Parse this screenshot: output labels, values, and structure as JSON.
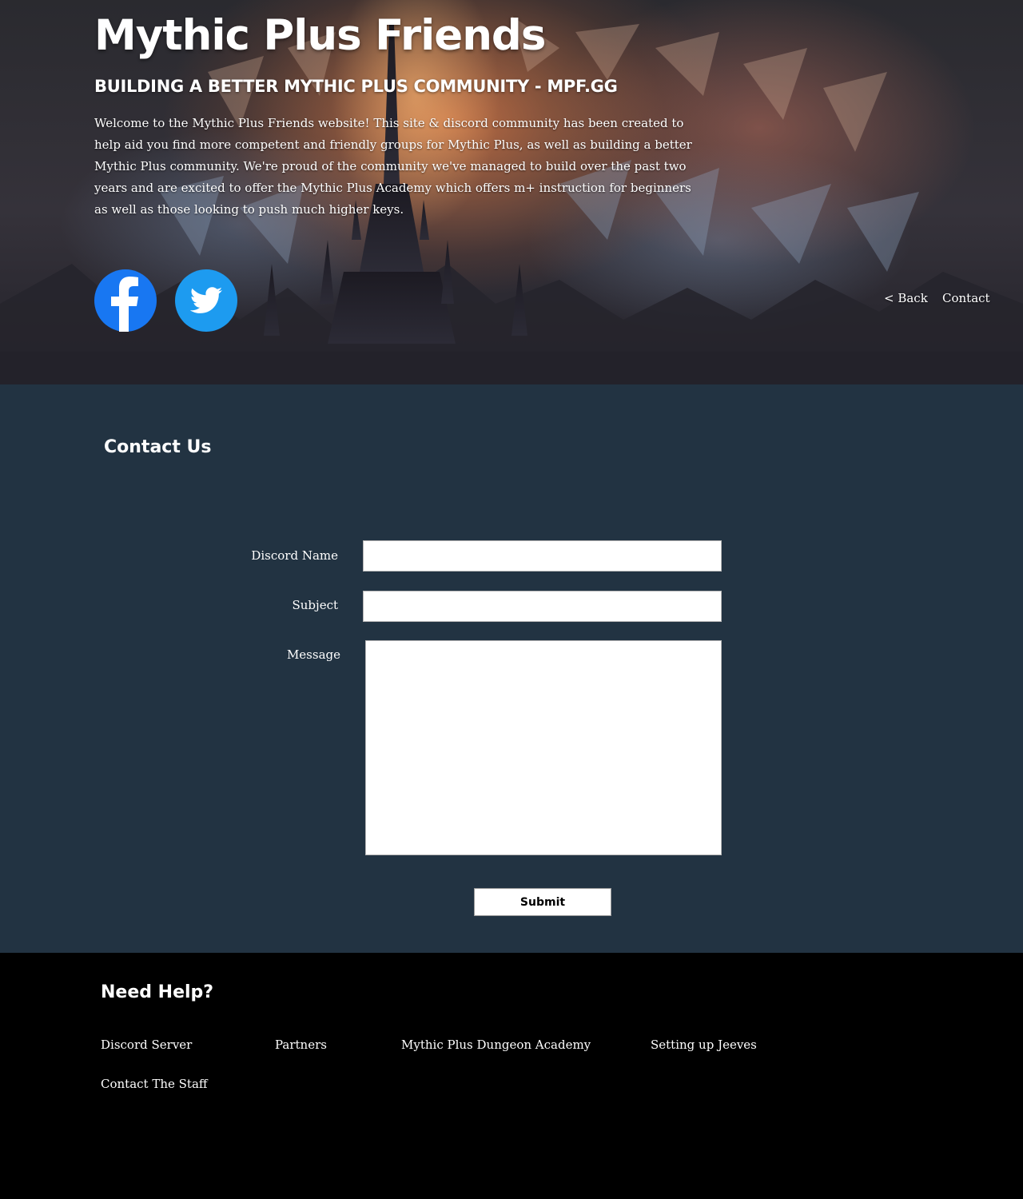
{
  "hero": {
    "title": "Mythic Plus Friends",
    "tagline": "BUILDING A BETTER MYTHIC PLUS COMMUNITY - MPF.GG",
    "intro": "Welcome to the Mythic Plus Friends website! This site & discord community has been created to help aid you find more competent and friendly groups for Mythic Plus, as well as building a better Mythic Plus community. We're proud of the community we've managed to build over the past two years and are excited to offer the Mythic Plus Academy which offers m+ instruction for beginners as well as those looking to push much higher keys.",
    "social": [
      {
        "icon": "facebook-icon",
        "color": "#1877f2"
      },
      {
        "icon": "twitter-icon",
        "color": "#1d9bf0"
      }
    ],
    "nav": {
      "back_label": "< Back",
      "contact_label": "Contact"
    }
  },
  "contact": {
    "title": "Contact Us",
    "background": "#223342",
    "fields": {
      "discord_name_label": "Discord Name",
      "discord_name_value": "",
      "subject_label": "Subject",
      "subject_value": "",
      "message_label": "Message",
      "message_value": ""
    },
    "submit_label": "Submit"
  },
  "footer": {
    "title": "Need Help?",
    "links": [
      "Discord Server",
      "Partners",
      "Mythic Plus Dungeon Academy",
      "Setting up Jeeves",
      "Contact The Staff"
    ]
  }
}
